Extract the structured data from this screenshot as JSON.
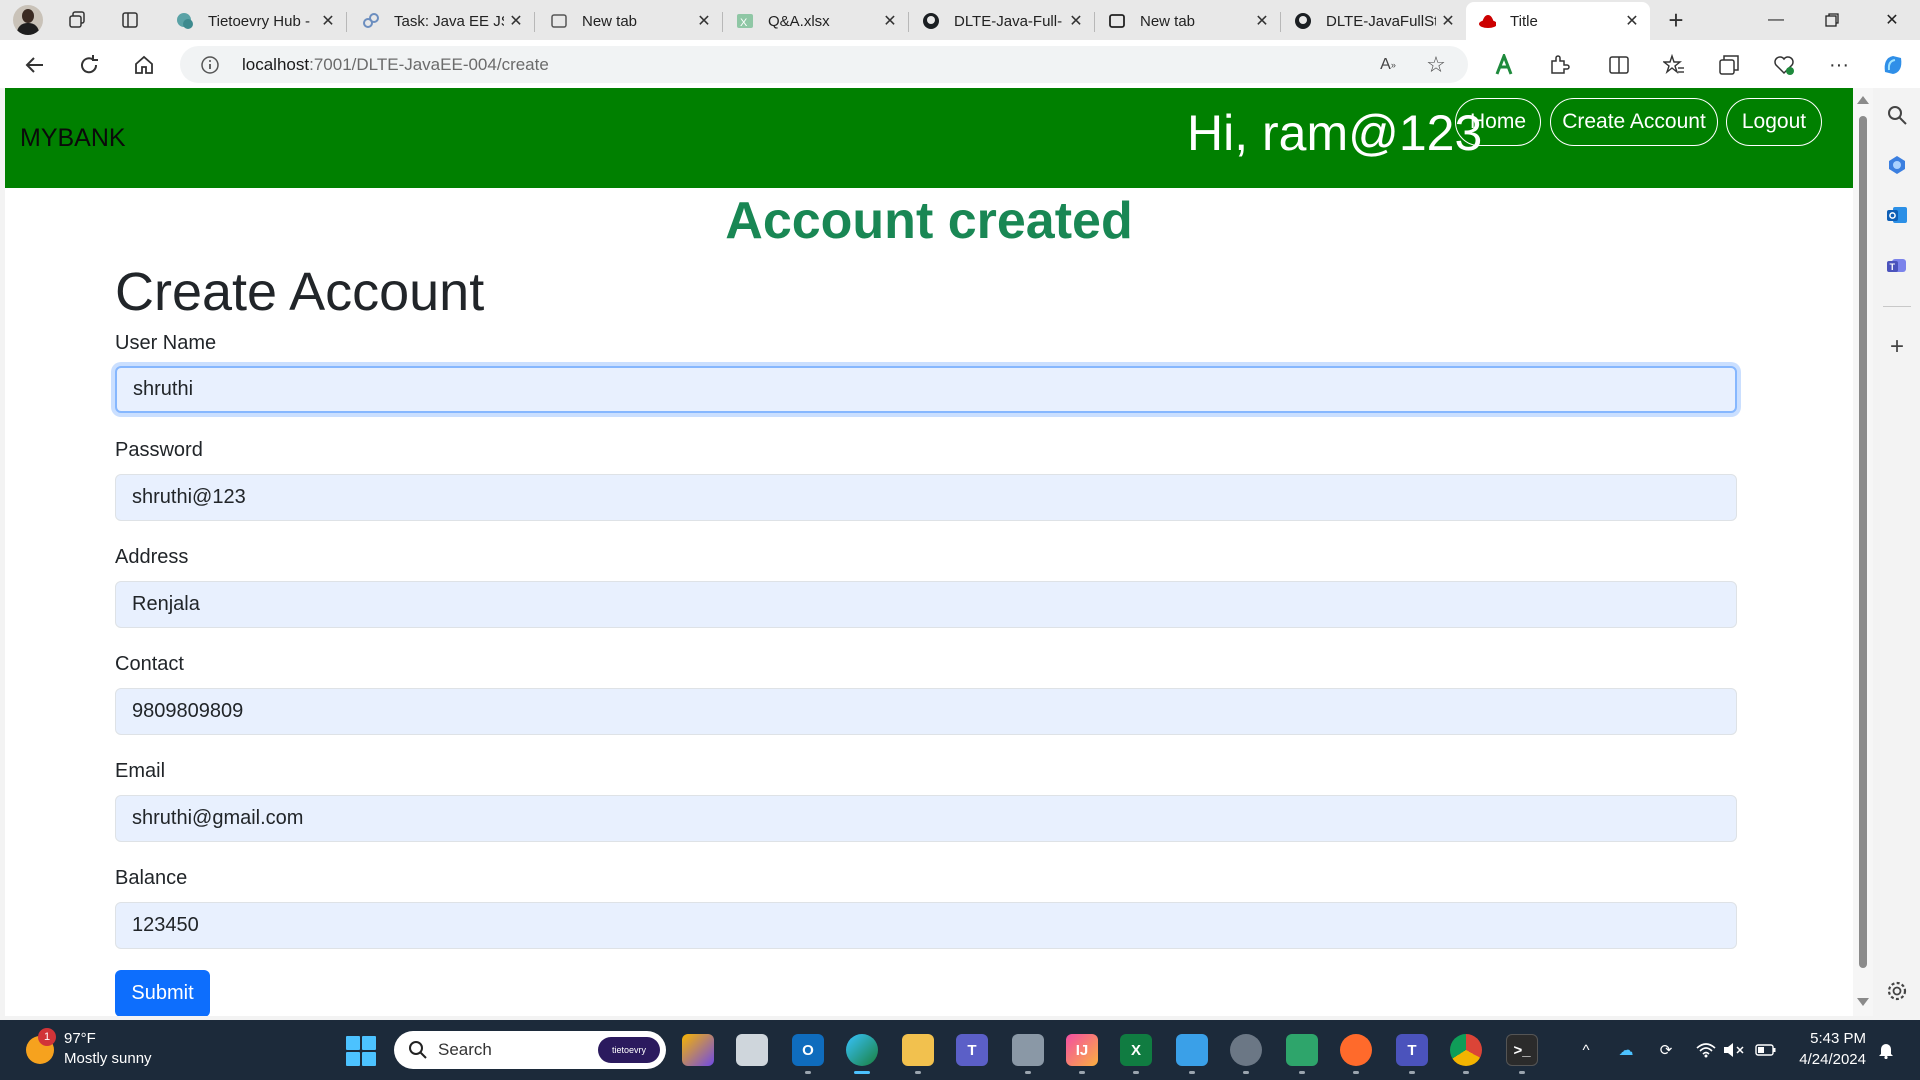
{
  "browser": {
    "tabs": [
      {
        "title": "Tietoevry Hub -"
      },
      {
        "title": "Task: Java EE JSF"
      },
      {
        "title": "New tab"
      },
      {
        "title": "Q&A.xlsx"
      },
      {
        "title": "DLTE-Java-Full-"
      },
      {
        "title": "New tab"
      },
      {
        "title": "DLTE-JavaFullSt"
      },
      {
        "title": "Title"
      }
    ],
    "url_host": "localhost",
    "url_path": ":7001/DLTE-JavaEE-004/create"
  },
  "app": {
    "brand": "MYBANK",
    "greeting": "Hi, ram@123",
    "nav": {
      "home": "Home",
      "create_account": "Create Account",
      "logout": "Logout"
    },
    "banner": "Account created",
    "page_title": "Create Account",
    "form": {
      "username_label": "User Name",
      "username_value": "shruthi",
      "password_label": "Password",
      "password_value": "shruthi@123",
      "address_label": "Address",
      "address_value": "Renjala",
      "contact_label": "Contact",
      "contact_value": "9809809809",
      "email_label": "Email",
      "email_value": "shruthi@gmail.com",
      "balance_label": "Balance",
      "balance_value": "123450",
      "submit_label": "Submit"
    },
    "colors": {
      "navbar": "#008000",
      "banner": "#198754",
      "submit": "#0d6efd"
    }
  },
  "taskbar": {
    "weather_badge": "1",
    "weather_temp": "97°F",
    "weather_desc": "Mostly sunny",
    "search_placeholder": "Search",
    "search_brand": "tietoevry",
    "time": "5:43 PM",
    "date": "4/24/2024"
  }
}
